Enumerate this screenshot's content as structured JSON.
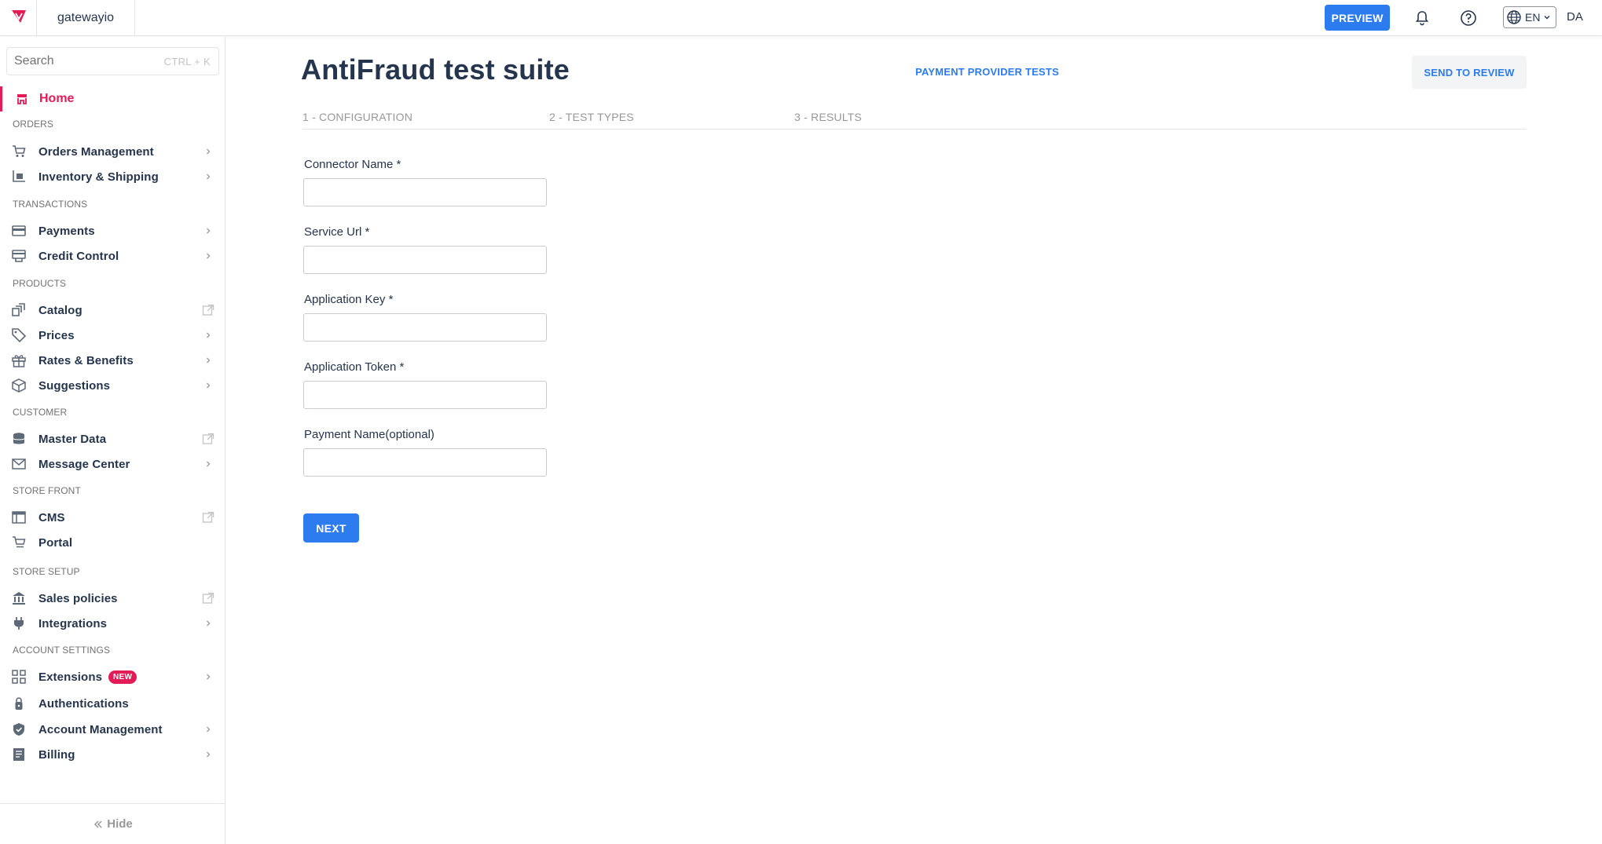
{
  "topbar": {
    "account_name": "gatewayio",
    "preview_label": "PREVIEW",
    "language": "EN",
    "user_initials": "DA",
    "logo_color": "#e31c58",
    "accent_color": "#2c7cf0"
  },
  "sidebar": {
    "search_placeholder": "Search",
    "search_shortcut": "CTRL + K",
    "home_label": "Home",
    "sections": {
      "orders": "ORDERS",
      "transactions": "TRANSACTIONS",
      "products": "PRODUCTS",
      "customer": "CUSTOMER",
      "store_front": "STORE FRONT",
      "store_setup": "STORE SETUP",
      "account_settings": "ACCOUNT SETTINGS"
    },
    "items": [
      {
        "label": "Orders Management",
        "icon": "cart-icon",
        "trail": "chevron"
      },
      {
        "label": "Inventory & Shipping",
        "icon": "dolly-icon",
        "trail": "chevron"
      },
      {
        "label": "Payments",
        "icon": "card-icon",
        "trail": "chevron"
      },
      {
        "label": "Credit Control",
        "icon": "credit-icon",
        "trail": "chevron"
      },
      {
        "label": "Catalog",
        "icon": "catalog-icon",
        "trail": "external"
      },
      {
        "label": "Prices",
        "icon": "tag-icon",
        "trail": "chevron"
      },
      {
        "label": "Rates & Benefits",
        "icon": "gift-icon",
        "trail": "chevron"
      },
      {
        "label": "Suggestions",
        "icon": "box-icon",
        "trail": "chevron"
      },
      {
        "label": "Master Data",
        "icon": "database-icon",
        "trail": "external"
      },
      {
        "label": "Message Center",
        "icon": "mail-icon",
        "trail": "chevron"
      },
      {
        "label": "CMS",
        "icon": "layout-icon",
        "trail": "external"
      },
      {
        "label": "Portal",
        "icon": "storefront-cart-icon",
        "trail": "none"
      },
      {
        "label": "Sales policies",
        "icon": "bank-icon",
        "trail": "external"
      },
      {
        "label": "Integrations",
        "icon": "plug-icon",
        "trail": "chevron"
      },
      {
        "label": "Extensions",
        "icon": "grid-icon",
        "trail": "chevron",
        "badge": "NEW"
      },
      {
        "label": "Authentications",
        "icon": "lock-icon",
        "trail": "none"
      },
      {
        "label": "Account Management",
        "icon": "shield-icon",
        "trail": "chevron"
      },
      {
        "label": "Billing",
        "icon": "invoice-icon",
        "trail": "chevron"
      }
    ],
    "hide_label": "Hide"
  },
  "main": {
    "title": "AntiFraud test suite",
    "payment_provider_tests": "PAYMENT PROVIDER TESTS",
    "send_to_review": "SEND TO REVIEW",
    "steps": [
      "1 - CONFIGURATION",
      "2 - TEST TYPES",
      "3 - RESULTS"
    ],
    "fields": [
      {
        "label": "Connector Name *",
        "value": ""
      },
      {
        "label": "Service Url *",
        "value": ""
      },
      {
        "label": "Application Key *",
        "value": ""
      },
      {
        "label": "Application Token *",
        "value": ""
      },
      {
        "label": "Payment Name(optional)",
        "value": ""
      }
    ],
    "next_label": "NEXT"
  }
}
